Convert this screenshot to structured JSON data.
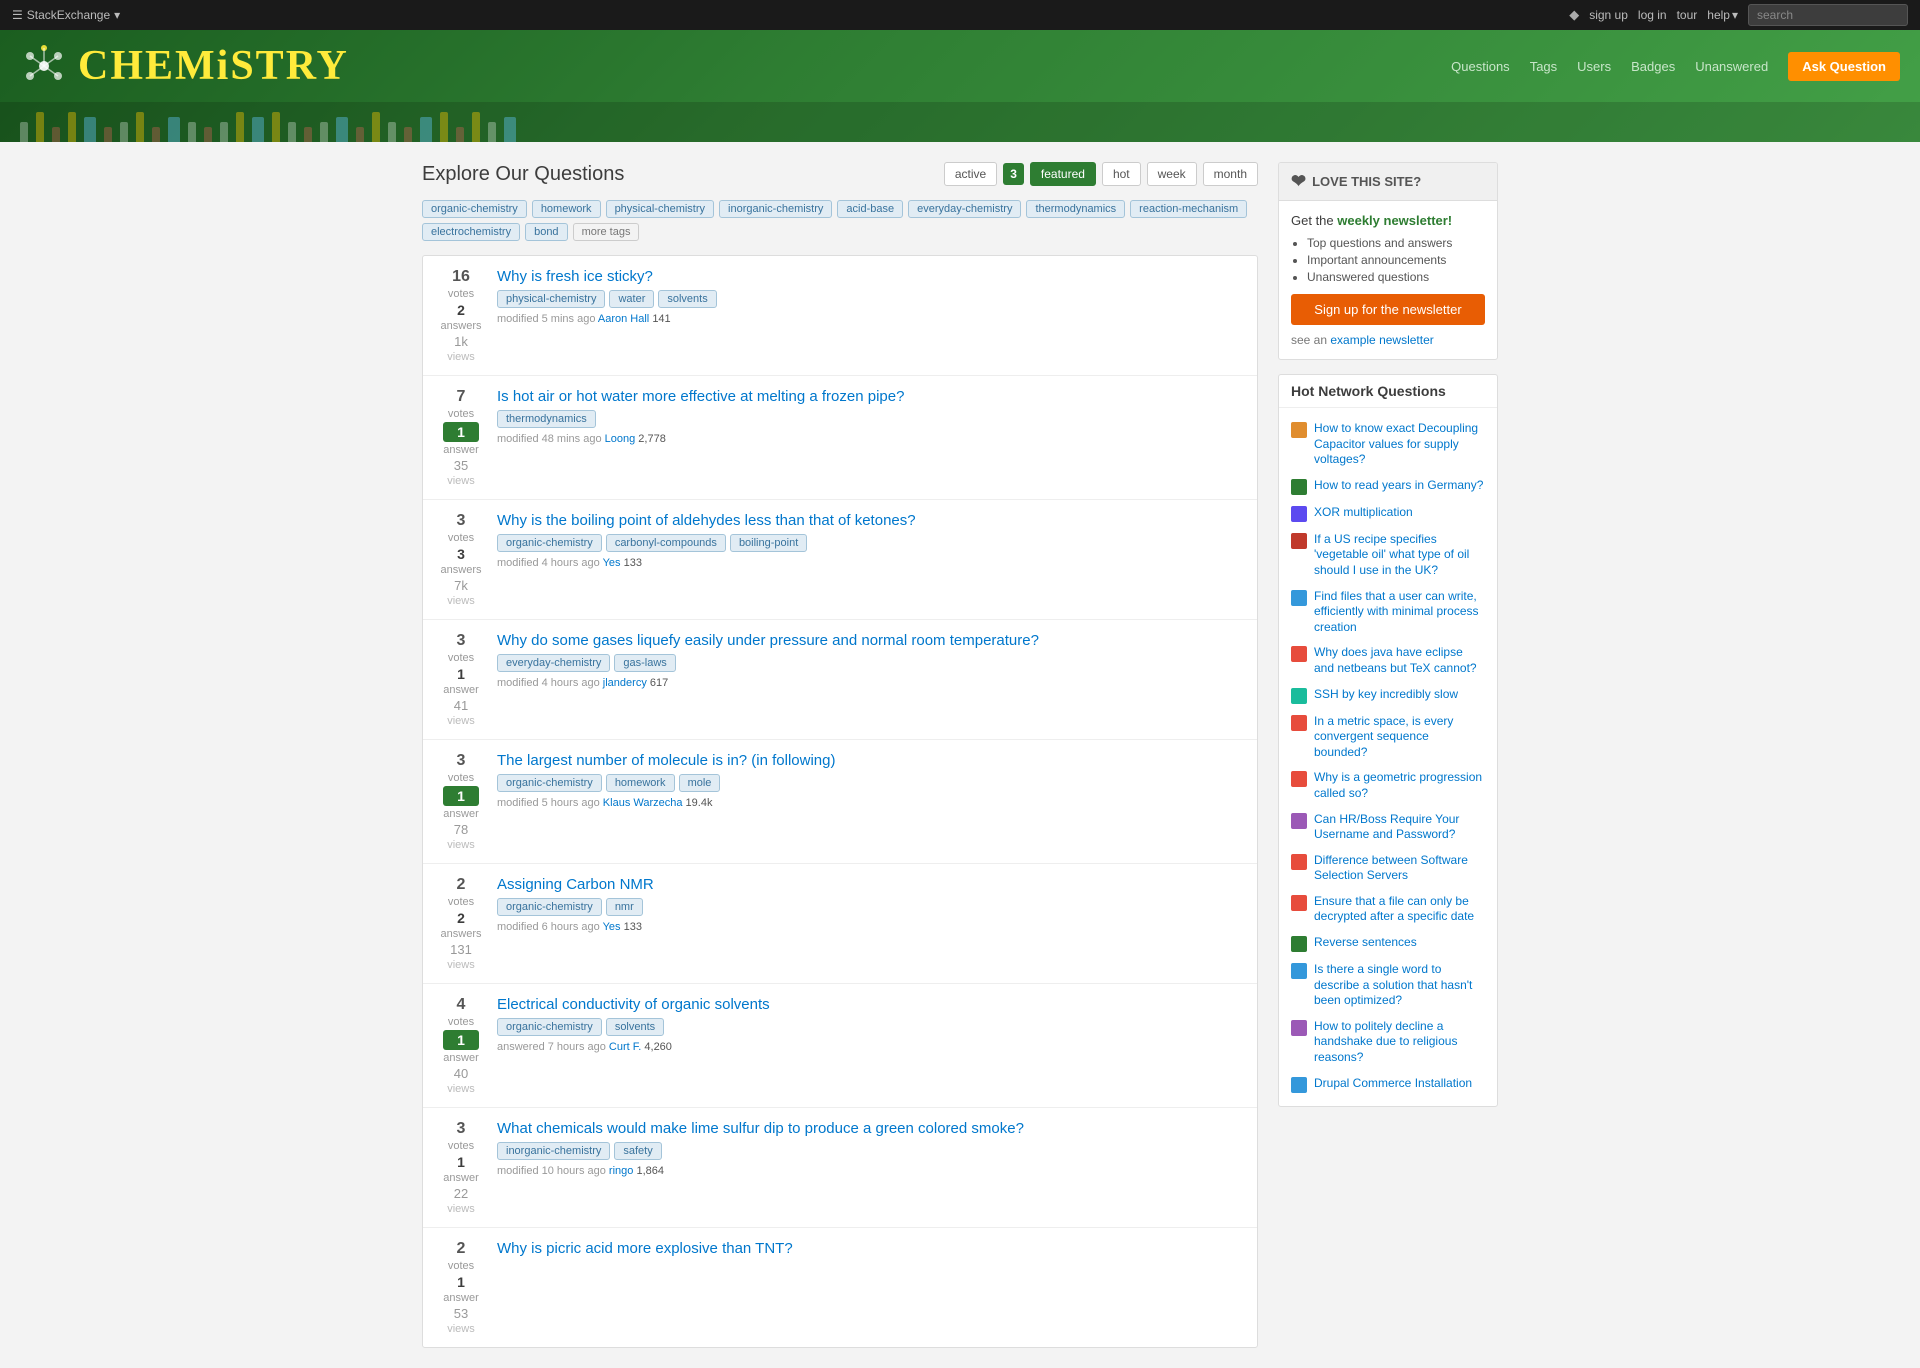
{
  "topbar": {
    "stack_exchange_label": "StackExchange",
    "sign_up": "sign up",
    "log_in": "log in",
    "tour": "tour",
    "help": "help",
    "search_placeholder": "search"
  },
  "header": {
    "site_title_prefix": "CHEMi",
    "site_title_suffix": "STRY",
    "nav": {
      "questions": "Questions",
      "tags": "Tags",
      "users": "Users",
      "badges": "Badges",
      "unanswered": "Unanswered",
      "ask_question": "Ask Question"
    }
  },
  "explore": {
    "title": "Explore Our Questions",
    "filters": [
      {
        "label": "active",
        "active": false
      },
      {
        "label": "3",
        "active": true,
        "is_num": true
      },
      {
        "label": "featured",
        "active": true
      },
      {
        "label": "hot",
        "active": false
      },
      {
        "label": "week",
        "active": false
      },
      {
        "label": "month",
        "active": false
      }
    ]
  },
  "tags": [
    "organic-chemistry",
    "homework",
    "physical-chemistry",
    "inorganic-chemistry",
    "acid-base",
    "everyday-chemistry",
    "thermodynamics",
    "reaction-mechanism",
    "electrochemistry",
    "bond",
    "more tags"
  ],
  "questions": [
    {
      "votes": 16,
      "votes_lbl": "votes",
      "answers": 2,
      "answers_lbl": "answers",
      "answered": false,
      "views": "1k",
      "views_lbl": "views",
      "title": "Why is fresh ice sticky?",
      "tags": [
        "physical-chemistry",
        "water",
        "solvents"
      ],
      "meta": "modified 5 mins ago",
      "user": "Aaron Hall",
      "rep": "141"
    },
    {
      "votes": 7,
      "votes_lbl": "votes",
      "answers": 1,
      "answers_lbl": "answer",
      "answered": true,
      "views": "35",
      "views_lbl": "views",
      "title": "Is hot air or hot water more effective at melting a frozen pipe?",
      "tags": [
        "thermodynamics"
      ],
      "meta": "modified 48 mins ago",
      "user": "Loong",
      "rep": "2,778"
    },
    {
      "votes": 3,
      "votes_lbl": "votes",
      "answers": 3,
      "answers_lbl": "answers",
      "answered": false,
      "views": "7k",
      "views_lbl": "views",
      "title": "Why is the boiling point of aldehydes less than that of ketones?",
      "tags": [
        "organic-chemistry",
        "carbonyl-compounds",
        "boiling-point"
      ],
      "meta": "modified 4 hours ago",
      "user": "Yes",
      "rep": "133"
    },
    {
      "votes": 3,
      "votes_lbl": "votes",
      "answers": 1,
      "answers_lbl": "answer",
      "answered": false,
      "views": "41",
      "views_lbl": "views",
      "title": "Why do some gases liquefy easily under pressure and normal room temperature?",
      "tags": [
        "everyday-chemistry",
        "gas-laws"
      ],
      "meta": "modified 4 hours ago",
      "user": "jlandercy",
      "rep": "617"
    },
    {
      "votes": 3,
      "votes_lbl": "votes",
      "answers": 1,
      "answers_lbl": "answer",
      "answered": true,
      "views": "78",
      "views_lbl": "views",
      "title": "The largest number of molecule is in? (in following)",
      "tags": [
        "organic-chemistry",
        "homework",
        "mole"
      ],
      "meta": "modified 5 hours ago",
      "user": "Klaus Warzecha",
      "rep": "19.4k"
    },
    {
      "votes": 2,
      "votes_lbl": "votes",
      "answers": 2,
      "answers_lbl": "answers",
      "answered": false,
      "views": "131",
      "views_lbl": "views",
      "title": "Assigning Carbon NMR",
      "tags": [
        "organic-chemistry",
        "nmr"
      ],
      "meta": "modified 6 hours ago",
      "user": "Yes",
      "rep": "133"
    },
    {
      "votes": 4,
      "votes_lbl": "votes",
      "answers": 1,
      "answers_lbl": "answer",
      "answered": true,
      "views": "40",
      "views_lbl": "views",
      "title": "Electrical conductivity of organic solvents",
      "tags": [
        "organic-chemistry",
        "solvents"
      ],
      "meta": "answered 7 hours ago",
      "user": "Curt F.",
      "rep": "4,260"
    },
    {
      "votes": 3,
      "votes_lbl": "votes",
      "answers": 1,
      "answers_lbl": "answer",
      "answered": false,
      "views": "22",
      "views_lbl": "views",
      "title": "What chemicals would make lime sulfur dip to produce a green colored smoke?",
      "tags": [
        "inorganic-chemistry",
        "safety"
      ],
      "meta": "modified 10 hours ago",
      "user": "ringo",
      "rep": "1,864"
    },
    {
      "votes": 2,
      "votes_lbl": "votes",
      "answers": 1,
      "answers_lbl": "answer",
      "answered": false,
      "views": "53",
      "views_lbl": "views",
      "title": "Why is picric acid more explosive than TNT?",
      "tags": [],
      "meta": "",
      "user": "",
      "rep": ""
    }
  ],
  "newsletter": {
    "header": "LOVE THIS SITE?",
    "get_label": "Get the",
    "weekly_label": "weekly newsletter!",
    "bullets": [
      "Top questions and answers",
      "Important announcements",
      "Unanswered questions"
    ],
    "button_label": "Sign up for the newsletter",
    "see_label": "see an",
    "example_label": "example newsletter"
  },
  "hot_network": {
    "title": "Hot Network Questions",
    "items": [
      {
        "site_color": "#e08d2e",
        "text": "How to know exact Decoupling Capacitor values for supply voltages?"
      },
      {
        "site_color": "#2e7d32",
        "text": "How to read years in Germany?"
      },
      {
        "site_color": "#5c4af0",
        "text": "XOR multiplication"
      },
      {
        "site_color": "#c0392b",
        "text": "If a US recipe specifies 'vegetable oil' what type of oil should I use in the UK?"
      },
      {
        "site_color": "#3498db",
        "text": "Find files that a user can write, efficiently with minimal process creation"
      },
      {
        "site_color": "#e74c3c",
        "text": "Why does java have eclipse and netbeans but TeX cannot?"
      },
      {
        "site_color": "#1abc9c",
        "text": "SSH by key incredibly slow"
      },
      {
        "site_color": "#e74c3c",
        "text": "In a metric space, is every convergent sequence bounded?"
      },
      {
        "site_color": "#e74c3c",
        "text": "Why is a geometric progression called so?"
      },
      {
        "site_color": "#9b59b6",
        "text": "Can HR/Boss Require Your Username and Password?"
      },
      {
        "site_color": "#e74c3c",
        "text": "Difference between Software Selection Servers"
      },
      {
        "site_color": "#e74c3c",
        "text": "Ensure that a file can only be decrypted after a specific date"
      },
      {
        "site_color": "#2e7d32",
        "text": "Reverse sentences"
      },
      {
        "site_color": "#3498db",
        "text": "Is there a single word to describe a solution that hasn't been optimized?"
      },
      {
        "site_color": "#9b59b6",
        "text": "How to politely decline a handshake due to religious reasons?"
      },
      {
        "site_color": "#3498db",
        "text": "Drupal Commerce Installation"
      }
    ]
  }
}
